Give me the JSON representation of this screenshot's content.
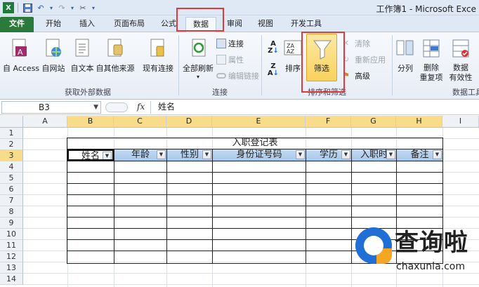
{
  "window": {
    "title": "工作簿1 - Microsoft Exce"
  },
  "tabs": [
    "文件",
    "开始",
    "插入",
    "页面布局",
    "公式",
    "数据",
    "审阅",
    "视图",
    "开发工具"
  ],
  "ribbon": {
    "get_external": {
      "label": "获取外部数据",
      "buttons": [
        "自 Access",
        "自网站",
        "自文本",
        "自其他来源",
        "现有连接"
      ]
    },
    "connections": {
      "label": "连接",
      "refresh_all": "全部刷新",
      "items": [
        "连接",
        "属性",
        "编辑链接"
      ]
    },
    "sort_filter": {
      "label": "排序和筛选",
      "sort": "排序",
      "filter": "筛选",
      "items": [
        "清除",
        "重新应用",
        "高级"
      ]
    },
    "data_tools": {
      "label": "数据工具",
      "buttons": [
        "分列",
        "删除\n重复项",
        "数据\n有效性"
      ]
    }
  },
  "formula_bar": {
    "name_box": "B3",
    "fx": "fx",
    "content": "姓名"
  },
  "columns": [
    "A",
    "B",
    "C",
    "D",
    "E",
    "F",
    "G",
    "H",
    "I"
  ],
  "rows": [
    "1",
    "2",
    "3",
    "4",
    "5",
    "6",
    "7",
    "8",
    "9",
    "10",
    "11",
    "12",
    "13",
    "14"
  ],
  "sheet": {
    "title": "入职登记表",
    "headers": [
      "姓名",
      "年龄",
      "性别",
      "身份证号码",
      "学历",
      "入职时",
      "备注"
    ]
  },
  "watermark": {
    "text": "查询啦",
    "url": "chaxunla.com"
  },
  "colors": {
    "accent_red": "#e23a3a",
    "file_tab": "#2a7a3c",
    "selection": "#f8dc8a"
  }
}
